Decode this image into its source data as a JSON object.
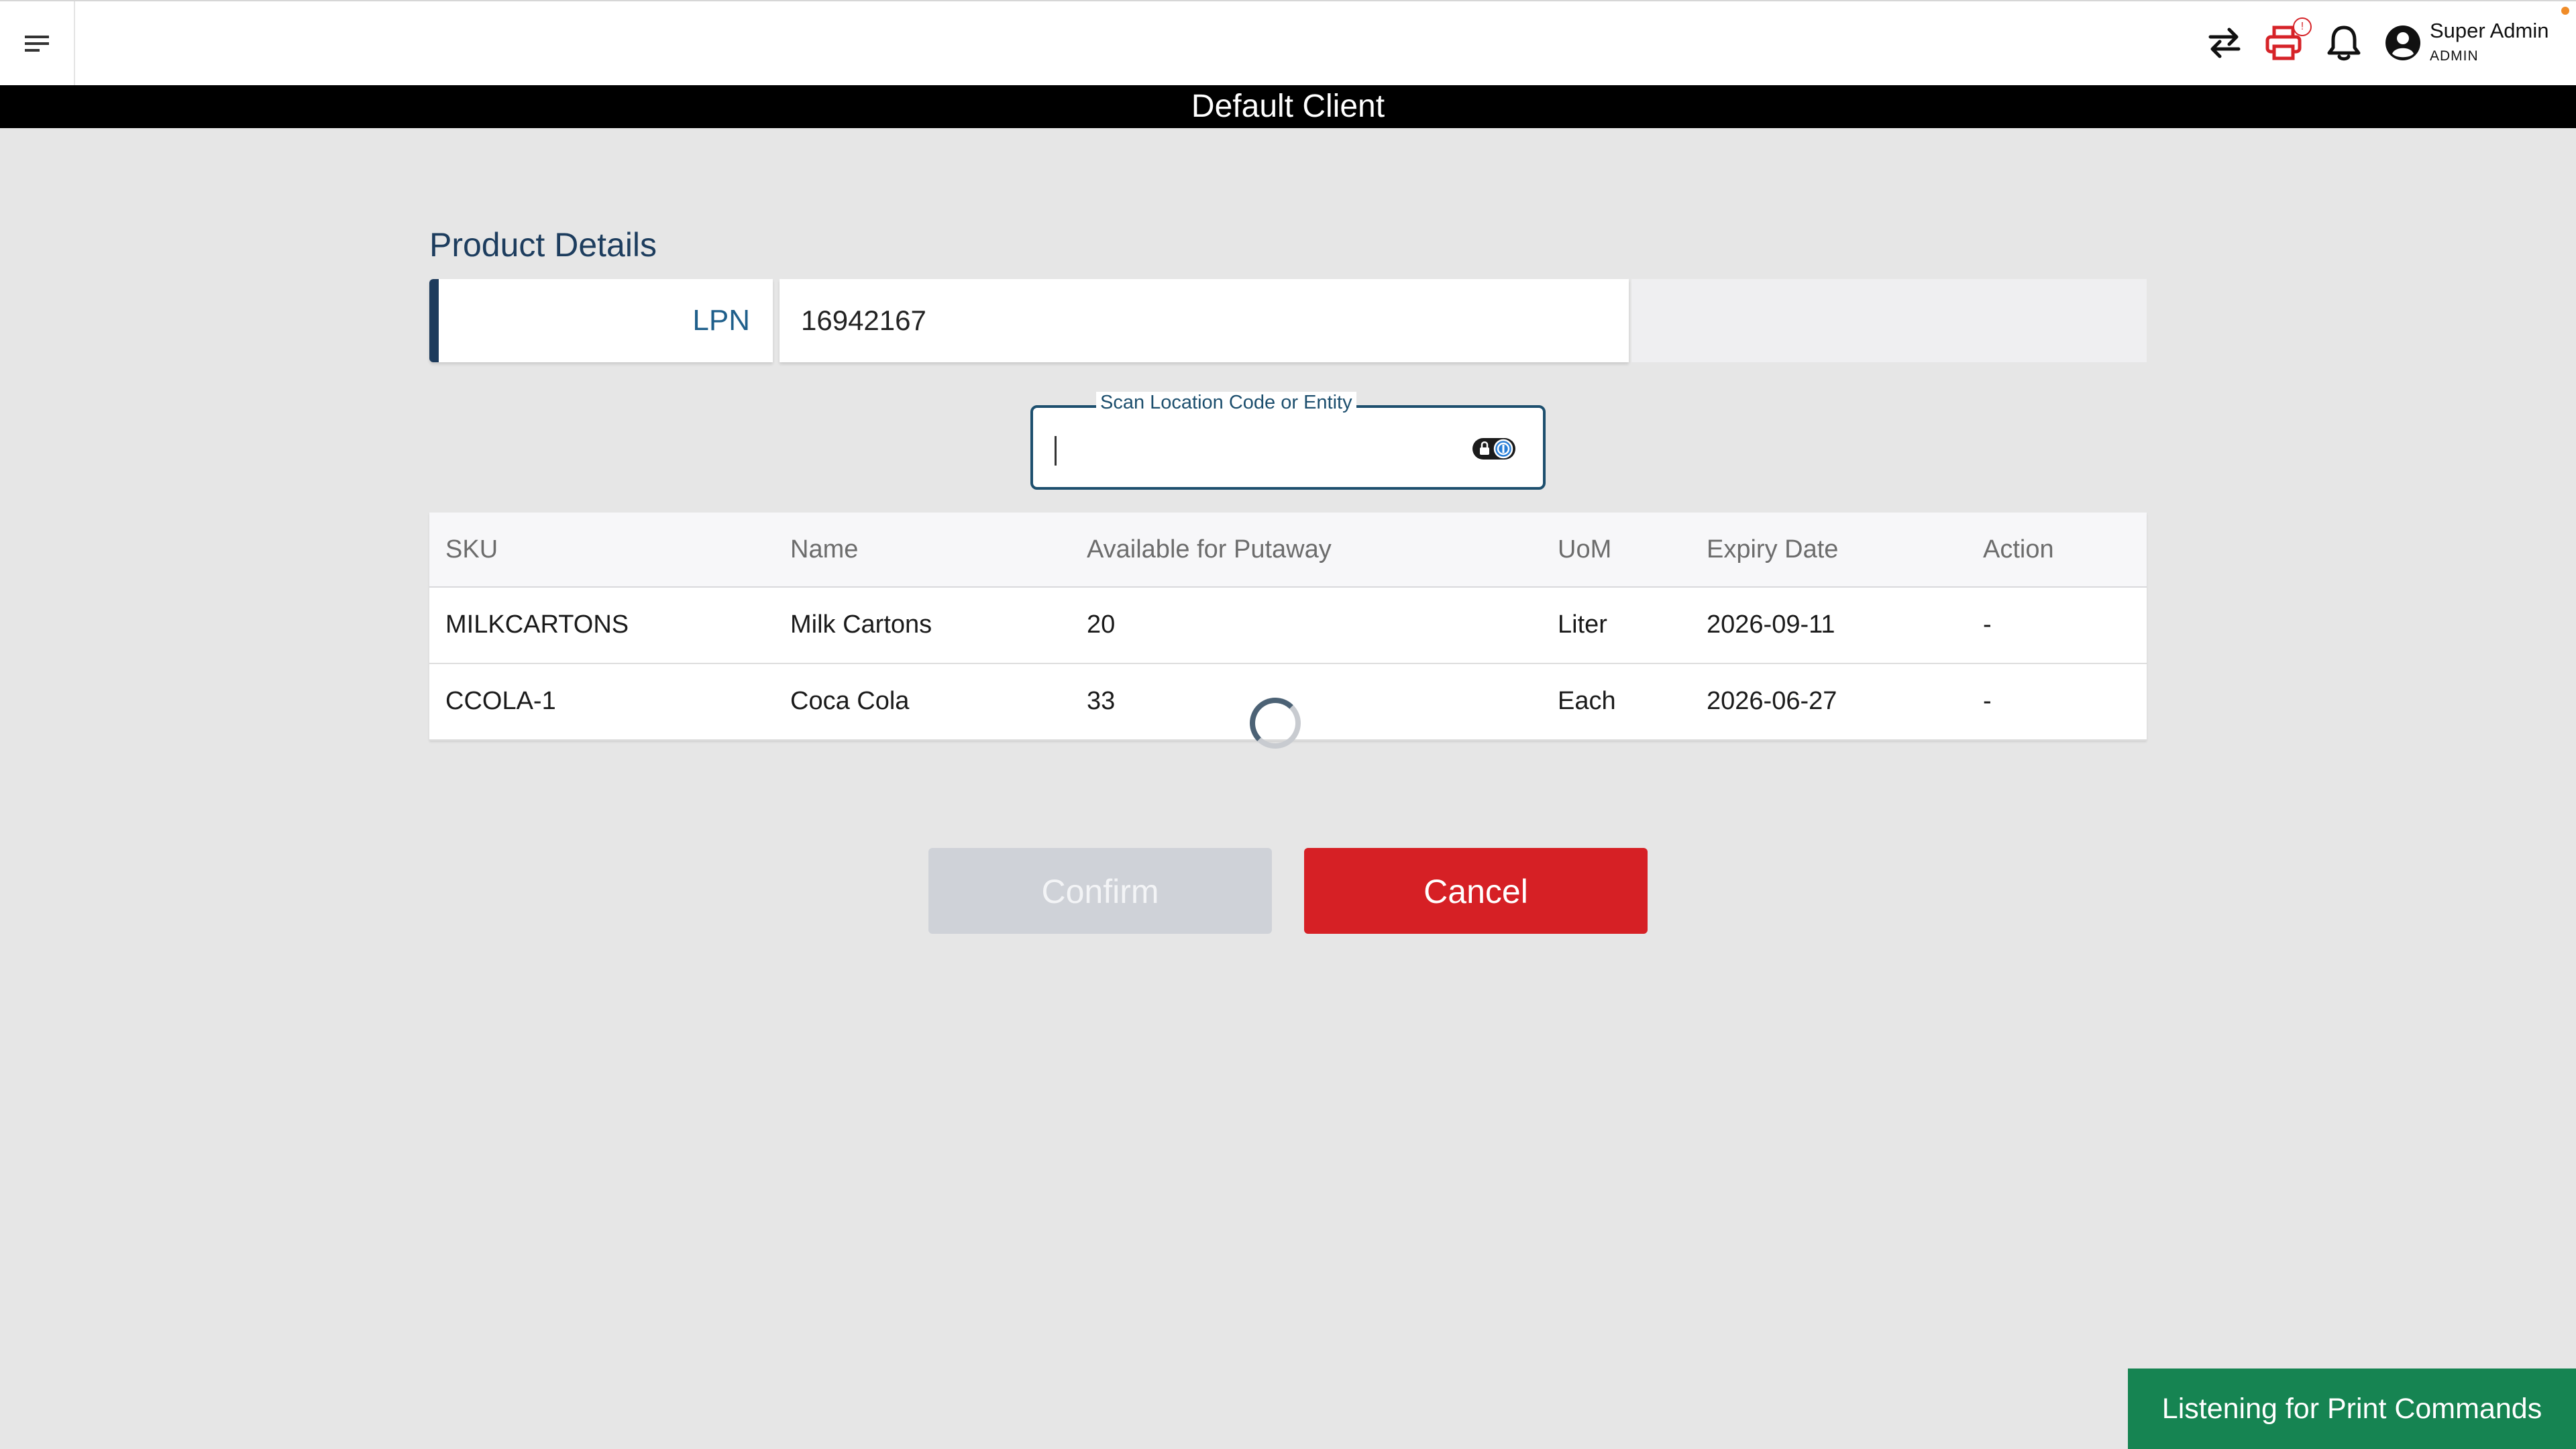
{
  "header": {
    "user_name": "Super Admin",
    "user_role": "ADMIN",
    "print_badge_count": "!",
    "icons": [
      "menu-icon",
      "swap-icon",
      "printer-icon",
      "bell-icon",
      "account-icon"
    ]
  },
  "client_banner": "Default Client",
  "product_details": {
    "title": "Product Details",
    "lpn_label": "LPN",
    "lpn_value": "16942167"
  },
  "scan": {
    "label": "Scan Location Code or Entity",
    "value": ""
  },
  "table": {
    "columns": [
      "SKU",
      "Name",
      "Available for Putaway",
      "UoM",
      "Expiry Date",
      "Action"
    ],
    "rows": [
      [
        "MILKCARTONS",
        "Milk Cartons",
        "20",
        "Liter",
        "2026-09-11",
        "-"
      ],
      [
        "CCOLA-1",
        "Coca Cola",
        "33",
        "Each",
        "2026-06-27",
        "-"
      ]
    ]
  },
  "buttons": {
    "confirm": "Confirm",
    "cancel": "Cancel"
  },
  "toast": "Listening for Print Commands",
  "colors": {
    "navy": "#1d3b5c",
    "cancel_red": "#d62025",
    "toast_green": "#168452",
    "confirm_disabled": "#cfd2d8"
  }
}
